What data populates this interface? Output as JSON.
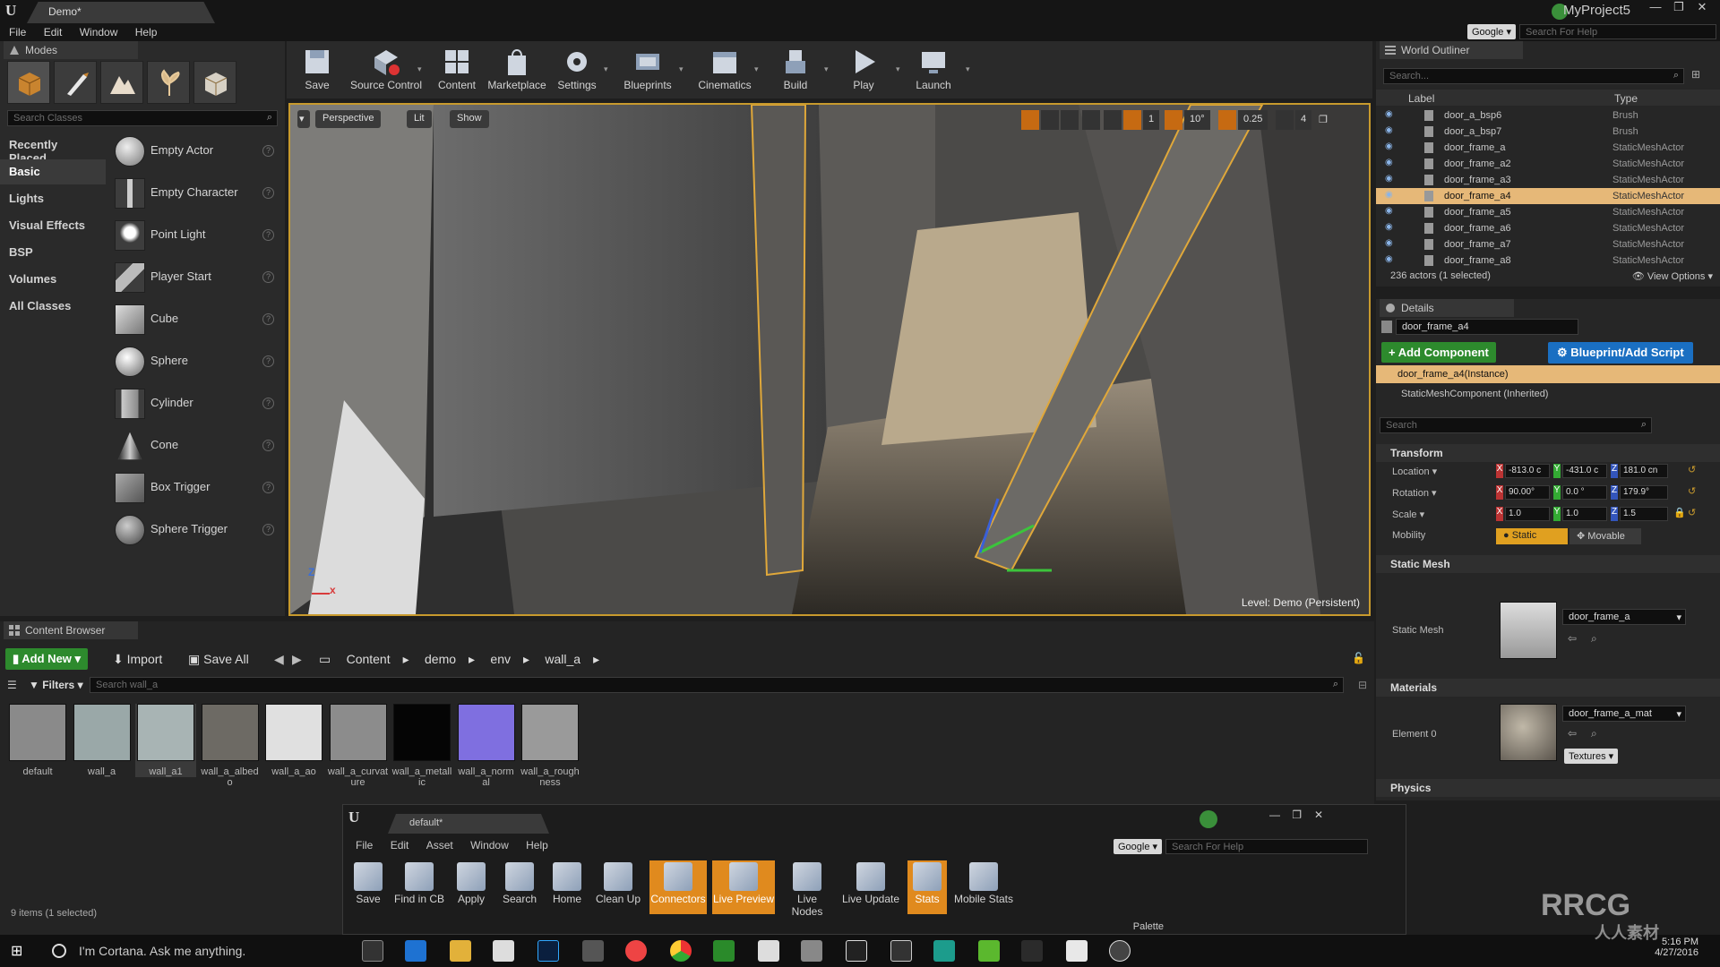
{
  "titlebar": {
    "tab_label": "Demo*",
    "project_name": "MyProject5",
    "min": "—",
    "max": "❐",
    "close": "✕"
  },
  "menubar": {
    "items": [
      "File",
      "Edit",
      "Window",
      "Help"
    ],
    "google_label": "Google",
    "help_search_placeholder": "Search For Help"
  },
  "modes": {
    "tab_label": "Modes",
    "search_placeholder": "Search Classes",
    "categories": [
      "Recently Placed",
      "Basic",
      "Lights",
      "Visual Effects",
      "BSP",
      "Volumes",
      "All Classes"
    ],
    "active_category": "Basic",
    "items": [
      "Empty Actor",
      "Empty Character",
      "Point Light",
      "Player Start",
      "Cube",
      "Sphere",
      "Cylinder",
      "Cone",
      "Box Trigger",
      "Sphere Trigger"
    ],
    "help_glyph": "?"
  },
  "toolbar": {
    "buttons": [
      "Save",
      "Source Control",
      "Content",
      "Marketplace",
      "Settings",
      "Blueprints",
      "Cinematics",
      "Build",
      "Play",
      "Launch"
    ]
  },
  "viewport": {
    "perspective_label": "Perspective",
    "lit_label": "Lit",
    "show_label": "Show",
    "grid_snap": "1",
    "rot_snap": "10°",
    "scale_snap": "0.25",
    "cam_speed": "4",
    "level_prefix": "Level:",
    "level_name": "Demo (Persistent)",
    "axis_z": "Z",
    "axis_x": "x"
  },
  "outliner": {
    "tab_label": "World Outliner",
    "search_placeholder": "Search...",
    "col_label": "Label",
    "col_type": "Type",
    "rows": [
      {
        "name": "door_a_bsp6",
        "type": "Brush"
      },
      {
        "name": "door_a_bsp7",
        "type": "Brush"
      },
      {
        "name": "door_frame_a",
        "type": "StaticMeshActor"
      },
      {
        "name": "door_frame_a2",
        "type": "StaticMeshActor"
      },
      {
        "name": "door_frame_a3",
        "type": "StaticMeshActor"
      },
      {
        "name": "door_frame_a4",
        "type": "StaticMeshActor"
      },
      {
        "name": "door_frame_a5",
        "type": "StaticMeshActor"
      },
      {
        "name": "door_frame_a6",
        "type": "StaticMeshActor"
      },
      {
        "name": "door_frame_a7",
        "type": "StaticMeshActor"
      },
      {
        "name": "door_frame_a8",
        "type": "StaticMeshActor"
      }
    ],
    "selected_name": "door_frame_a4",
    "status": "236 actors (1 selected)",
    "view_options": "View Options"
  },
  "details": {
    "tab_label": "Details",
    "actor_name": "door_frame_a4",
    "add_component": "+ Add Component",
    "blueprint_script": "Blueprint/Add Script",
    "instance_label": "door_frame_a4(Instance)",
    "component_label": "StaticMeshComponent (Inherited)",
    "search_placeholder": "Search",
    "transform_head": "Transform",
    "location_label": "Location",
    "location": {
      "x": "-813.0 c",
      "y": "-431.0 c",
      "z": "181.0 cn"
    },
    "rotation_label": "Rotation",
    "rotation": {
      "x": "90.00°",
      "y": "0.0 °",
      "z": "179.9°"
    },
    "scale_label": "Scale",
    "scale": {
      "x": "1.0",
      "y": "1.0",
      "z": "1.5"
    },
    "mobility_label": "Mobility",
    "mobility_static": "Static",
    "mobility_movable": "Movable",
    "static_mesh_head": "Static Mesh",
    "static_mesh_label": "Static Mesh",
    "static_mesh_value": "door_frame_a",
    "materials_head": "Materials",
    "element0_label": "Element 0",
    "material_value": "door_frame_a_mat",
    "textures_label": "Textures",
    "physics_head": "Physics",
    "axis_x": "X",
    "axis_y": "Y",
    "axis_z": "Z"
  },
  "content_browser": {
    "tab_label": "Content Browser",
    "add_new": "Add New",
    "import": "Import",
    "save_all": "Save All",
    "breadcrumbs": [
      "Content",
      "demo",
      "env",
      "wall_a"
    ],
    "filters": "Filters",
    "search_placeholder": "Search wall_a",
    "assets": [
      {
        "name": "default",
        "color": "#8a8a8a"
      },
      {
        "name": "wall_a",
        "color": "#9aa8a8"
      },
      {
        "name": "wall_a1",
        "color": "#a8b4b4"
      },
      {
        "name": "wall_a_albedo",
        "color": "#6d6a64"
      },
      {
        "name": "wall_a_ao",
        "color": "#e0e0e0"
      },
      {
        "name": "wall_a_curvature",
        "color": "#8c8c8c"
      },
      {
        "name": "wall_a_metallic",
        "color": "#050505"
      },
      {
        "name": "wall_a_normal",
        "color": "#7f6fe0"
      },
      {
        "name": "wall_a_roughness",
        "color": "#9a9a9a"
      }
    ],
    "selected_asset": "wall_a1",
    "status": "9 items (1 selected)"
  },
  "material_editor": {
    "tab_label": "default*",
    "menu": [
      "File",
      "Edit",
      "Asset",
      "Window",
      "Help"
    ],
    "google_label": "Google",
    "help_search_placeholder": "Search For Help",
    "buttons": [
      "Save",
      "Find in CB",
      "Apply",
      "Search",
      "Home",
      "Clean Up",
      "Connectors",
      "Live Preview",
      "Live Nodes",
      "Live Update",
      "Stats",
      "Mobile Stats"
    ],
    "highlighted": [
      "Connectors",
      "Live Preview",
      "Stats"
    ],
    "palette_label": "Palette"
  },
  "taskbar": {
    "cortana": "I'm Cortana. Ask me anything.",
    "time": "5:16 PM",
    "date": "4/27/2016"
  },
  "watermark": {
    "brand": "RRCG",
    "cjk": "人人素材"
  },
  "colors": {
    "selection_orange": "#c89a2d",
    "outliner_selected": "#e6b878",
    "add_new_green": "#2d8a2d",
    "blueprint_blue": "#1a6fc2",
    "mat_button_orange": "#e08a1e"
  }
}
